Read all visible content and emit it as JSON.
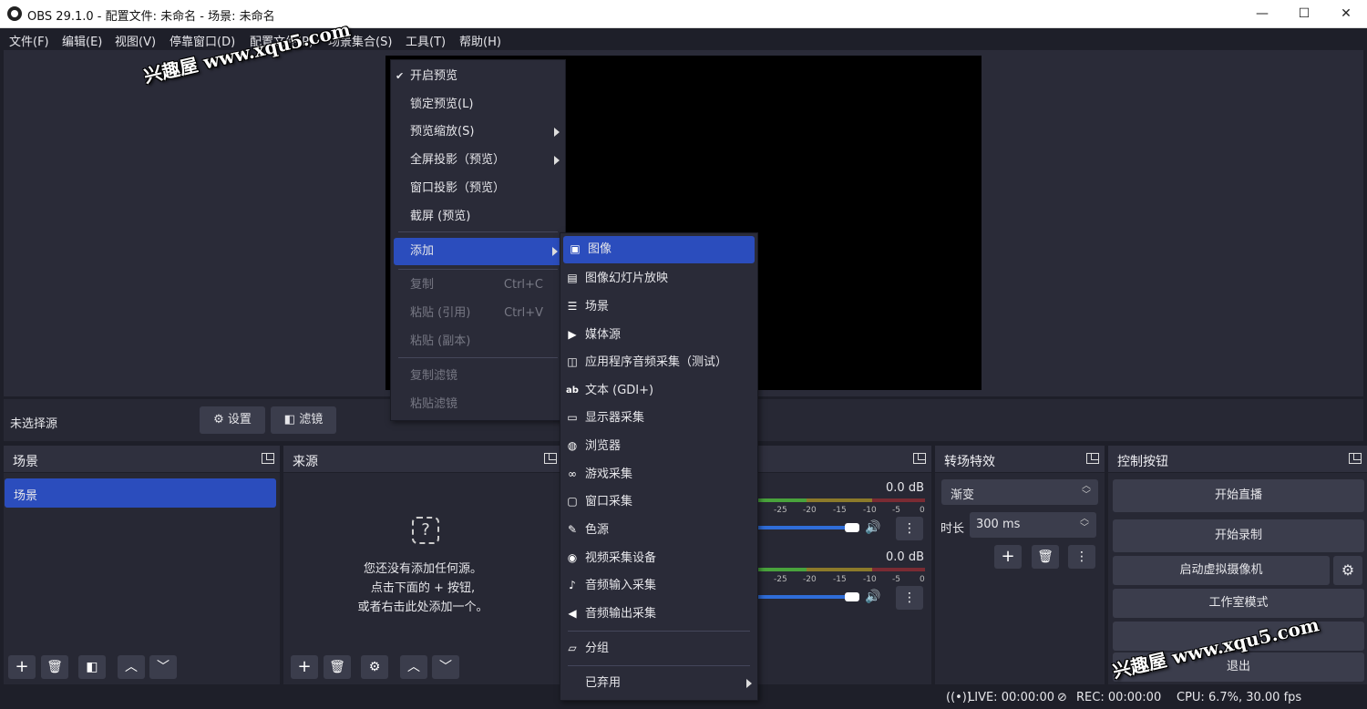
{
  "window": {
    "title": "OBS 29.1.0 - 配置文件: 未命名 - 场景: 未命名",
    "min": "—",
    "max": "☐",
    "close": "✕"
  },
  "menubar": [
    "文件(F)",
    "编辑(E)",
    "视图(V)",
    "停靠窗口(D)",
    "配置文件(P)",
    "场景集合(S)",
    "工具(T)",
    "帮助(H)"
  ],
  "context_menu": {
    "items": [
      {
        "label": "开启预览",
        "check": "✔"
      },
      {
        "label": "锁定预览(L)"
      },
      {
        "label": "预览缩放(S)"
      },
      {
        "label": "全屏投影（预览）"
      },
      {
        "label": "窗口投影（预览）"
      },
      {
        "label": "截屏 (预览)"
      },
      {
        "label": "添加"
      },
      {
        "label": "复制",
        "shortcut": "Ctrl+C"
      },
      {
        "label": "粘贴 (引用)",
        "shortcut": "Ctrl+V"
      },
      {
        "label": "粘贴 (副本)"
      },
      {
        "label": "复制滤镜"
      },
      {
        "label": "粘贴滤镜"
      }
    ]
  },
  "submenu": {
    "items": [
      "图像",
      "图像幻灯片放映",
      "场景",
      "媒体源",
      "应用程序音频采集（测试）",
      "文本 (GDI+)",
      "显示器采集",
      "浏览器",
      "游戏采集",
      "窗口采集",
      "色源",
      "视频采集设备",
      "音频输入采集",
      "音频输出采集",
      "分组",
      "已弃用"
    ]
  },
  "source_bar": {
    "no_source": "未选择源",
    "settings": "设置",
    "filters": "滤镜"
  },
  "docks": {
    "scenes": {
      "title": "场景",
      "items": [
        "场景"
      ]
    },
    "sources": {
      "title": "来源",
      "empty_line1": "您还没有添加任何源。",
      "empty_line2": "点击下面的 + 按钮,",
      "empty_line3": "或者右击此处添加一个。"
    },
    "mixer": {
      "db1": "0.0 dB",
      "db2": "0.0 dB",
      "ticks": [
        "-25",
        "-20",
        "-15",
        "-10",
        "-5",
        "0"
      ]
    },
    "transitions": {
      "title": "转场特效",
      "type": "渐变",
      "duration_label": "时长",
      "duration_value": "300 ms"
    },
    "controls": {
      "title": "控制按钮",
      "start_stream": "开始直播",
      "start_record": "开始录制",
      "virtual_cam": "启动虚拟摄像机",
      "studio_mode": "工作室模式",
      "exit": "退出"
    }
  },
  "status": {
    "live": "LIVE: 00:00:00",
    "rec": "REC: 00:00:00",
    "cpu": "CPU: 6.7%, 30.00 fps"
  },
  "watermark": "兴趣屋 www.xqu5.com",
  "colors": {
    "accent": "#2b4dbd",
    "bg": "#1e1f29",
    "panel": "#272834"
  }
}
